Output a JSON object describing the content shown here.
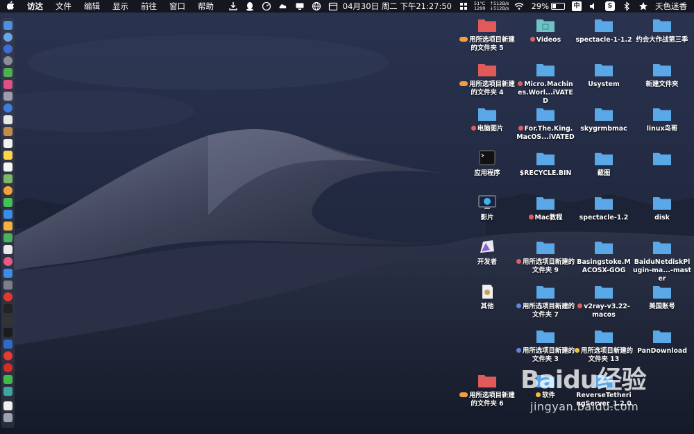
{
  "menubar": {
    "app_name": "访达",
    "menus": [
      "文件",
      "编辑",
      "显示",
      "前往",
      "窗口",
      "帮助"
    ],
    "cpu_temp": "51°C",
    "fan_rpm": "1299",
    "net_up": "↑512B/s",
    "net_down": "↓512B/s",
    "datetime": "04月30日 周二 下午21:27:50",
    "battery_percent": "29%",
    "input_method": "中",
    "username": "天色迷香"
  },
  "desktop": {
    "items": [
      {
        "name": "folder-item",
        "label": "用所选项目新建的文件夹 5",
        "icon": "red-folder",
        "tag": "double"
      },
      {
        "name": "folder-item",
        "label": "Videos",
        "icon": "video-folder",
        "tag": "red"
      },
      {
        "name": "folder-item",
        "label": "spectacle-1-1.2",
        "icon": "folder",
        "tag": ""
      },
      {
        "name": "folder-item",
        "label": "约会大作战第三季",
        "icon": "folder",
        "tag": ""
      },
      {
        "name": "folder-item",
        "label": "用所选项目新建的文件夹 4",
        "icon": "red-folder",
        "tag": "double"
      },
      {
        "name": "folder-item",
        "label": "Micro.Machines.Worl...iVATED",
        "icon": "folder",
        "tag": "red"
      },
      {
        "name": "folder-item",
        "label": "Usystem",
        "icon": "folder",
        "tag": ""
      },
      {
        "name": "folder-item",
        "label": "新建文件夹",
        "icon": "folder",
        "tag": ""
      },
      {
        "name": "folder-item",
        "label": "电脑图片",
        "icon": "folder",
        "tag": "red"
      },
      {
        "name": "folder-item",
        "label": "For.The.King.MacOS...iVATED",
        "icon": "folder",
        "tag": "red"
      },
      {
        "name": "folder-item",
        "label": "skygrmbmac",
        "icon": "folder",
        "tag": ""
      },
      {
        "name": "folder-item",
        "label": "linux鸟哥",
        "icon": "folder",
        "tag": ""
      },
      {
        "name": "folder-item",
        "label": "应用程序",
        "icon": "terminal",
        "tag": ""
      },
      {
        "name": "folder-item",
        "label": "$RECYCLE.BIN",
        "icon": "folder",
        "tag": ""
      },
      {
        "name": "folder-item",
        "label": "截图",
        "icon": "folder",
        "tag": ""
      },
      {
        "name": "folder-item",
        "label": "",
        "icon": "folder",
        "tag": ""
      },
      {
        "name": "folder-item",
        "label": "影片",
        "icon": "monitor",
        "tag": ""
      },
      {
        "name": "folder-item",
        "label": "Mac教程",
        "icon": "folder",
        "tag": "red"
      },
      {
        "name": "folder-item",
        "label": "spectacle-1.2",
        "icon": "folder",
        "tag": ""
      },
      {
        "name": "folder-item",
        "label": "disk",
        "icon": "folder",
        "tag": ""
      },
      {
        "name": "folder-item",
        "label": "开发者",
        "icon": "dev-app",
        "tag": ""
      },
      {
        "name": "folder-item",
        "label": "用所选项目新建的文件夹 9",
        "icon": "folder",
        "tag": "red"
      },
      {
        "name": "folder-item",
        "label": "Basingstoke.MACOSX-GOG",
        "icon": "folder",
        "tag": ""
      },
      {
        "name": "folder-item",
        "label": "BaiduNetdiskPlugin-ma...-master",
        "icon": "folder",
        "tag": ""
      },
      {
        "name": "folder-item",
        "label": "其他",
        "icon": "utility-app",
        "tag": ""
      },
      {
        "name": "folder-item",
        "label": "用所选项目新建的文件夹 7",
        "icon": "folder",
        "tag": "blue"
      },
      {
        "name": "folder-item",
        "label": "v2ray-v3.22-macos",
        "icon": "folder",
        "tag": "red"
      },
      {
        "name": "folder-item",
        "label": "美国账号",
        "icon": "folder",
        "tag": ""
      },
      {
        "name": "folder-item",
        "label": "",
        "icon": "",
        "tag": ""
      },
      {
        "name": "folder-item",
        "label": "用所选项目新建的文件夹 3",
        "icon": "folder",
        "tag": "blue"
      },
      {
        "name": "folder-item",
        "label": "用所选项目新建的文件夹 13",
        "icon": "folder",
        "tag": "yellow"
      },
      {
        "name": "folder-item",
        "label": "PanDownload",
        "icon": "folder",
        "tag": ""
      },
      {
        "name": "folder-item",
        "label": "用所选项目新建的文件夹 6",
        "icon": "red-folder",
        "tag": "double"
      },
      {
        "name": "folder-item",
        "label": "软件",
        "icon": "folder",
        "tag": "yellow"
      },
      {
        "name": "folder-item",
        "label": "ReverseTetheringServer_1.2.0",
        "icon": "folder",
        "tag": ""
      }
    ]
  },
  "watermark": {
    "logo_text": "Baidu经验",
    "url": "jingyan.baidu.com"
  },
  "colors": {
    "folder_blue": "#5aa8e6",
    "folder_red": "#e05a5a",
    "menubar_bg": "#12141c"
  }
}
